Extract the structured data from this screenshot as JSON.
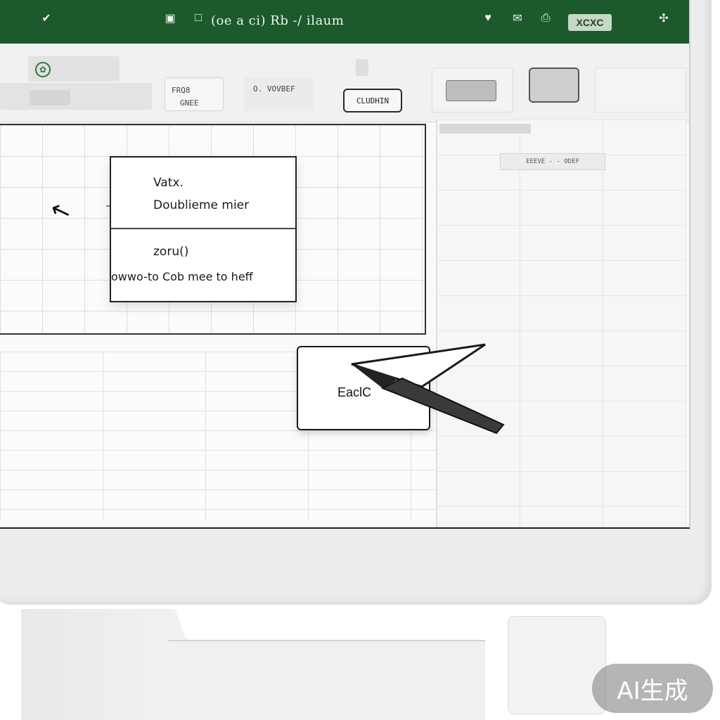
{
  "window": {
    "title": "(oe a ci) Rb -/ ilaum",
    "badge": "XCXC"
  },
  "ribbon": {
    "field_one": "FRQ8",
    "field_one_sub": "GNEE",
    "field_two": "O. VOVBEF",
    "button_label": "CLUDHIN"
  },
  "side_panel": {
    "label": "EEEVE - - ODEF"
  },
  "popup": {
    "line1": "Vatx.",
    "line2": "Doublieme mier",
    "line3": "zoru()",
    "line4": "owwo-to Cob mee to heff"
  },
  "callout": {
    "label": "EaclC"
  },
  "watermark": {
    "text": "AI生成"
  },
  "icons": {
    "app": "check-shield-icon",
    "save": "save-icon",
    "square": "square-icon",
    "heart": "heart-icon",
    "mail": "mail-icon",
    "printer": "printer-icon",
    "clover": "clover-icon"
  },
  "colors": {
    "titlebar": "#1c5a2c",
    "accent": "#2b7a3b"
  }
}
